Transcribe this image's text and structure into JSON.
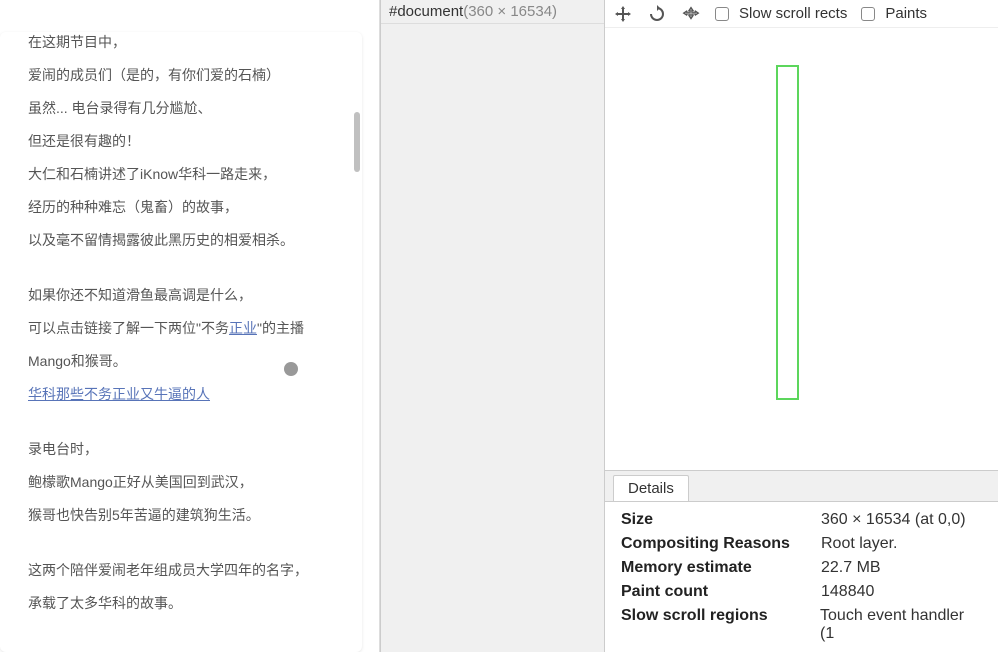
{
  "content": {
    "lines": [
      "在这期节目中，",
      "爱闹的成员们（是的，有你们爱的石楠）",
      "虽然... 电台录得有几分尴尬、",
      "但还是很有趣的！",
      "大仁和石楠讲述了iKnow华科一路走来，",
      "经历的种种难忘（鬼畜）的故事，",
      "以及毫不留情揭露彼此黑历史的相爱相杀。"
    ],
    "para2_before": "如果你还不知道滑鱼最高调是什么，",
    "para2_mixed_prefix": "可以点击链接了解一下两位\"不务",
    "para2_link_inline": "正业",
    "para2_mixed_suffix": "\"的主播",
    "para2_after": "Mango和猴哥。",
    "link_text": "华科那些不务正业又牛逼的人",
    "para3": [
      "录电台时，",
      "鲍檬歌Mango正好从美国回到武汉，",
      "猴哥也快告别5年苦逼的建筑狗生活。"
    ],
    "para4": [
      "这两个陪伴爱闹老年组成员大学四年的名字，",
      "承载了太多华科的故事。"
    ]
  },
  "doc_header": {
    "name": "#document",
    "dims": "(360 × 16534)"
  },
  "toolbar": {
    "slow_scroll": "Slow scroll rects",
    "paints": "Paints"
  },
  "tabs": {
    "details": "Details"
  },
  "details": {
    "rows": [
      {
        "label": "Size",
        "value": "360 × 16534 (at 0,0)"
      },
      {
        "label": "Compositing Reasons",
        "value": "Root layer."
      },
      {
        "label": "Memory estimate",
        "value": "22.7 MB"
      },
      {
        "label": "Paint count",
        "value": "148840"
      },
      {
        "label": "Slow scroll regions",
        "value": "Touch event handler (1"
      }
    ]
  }
}
